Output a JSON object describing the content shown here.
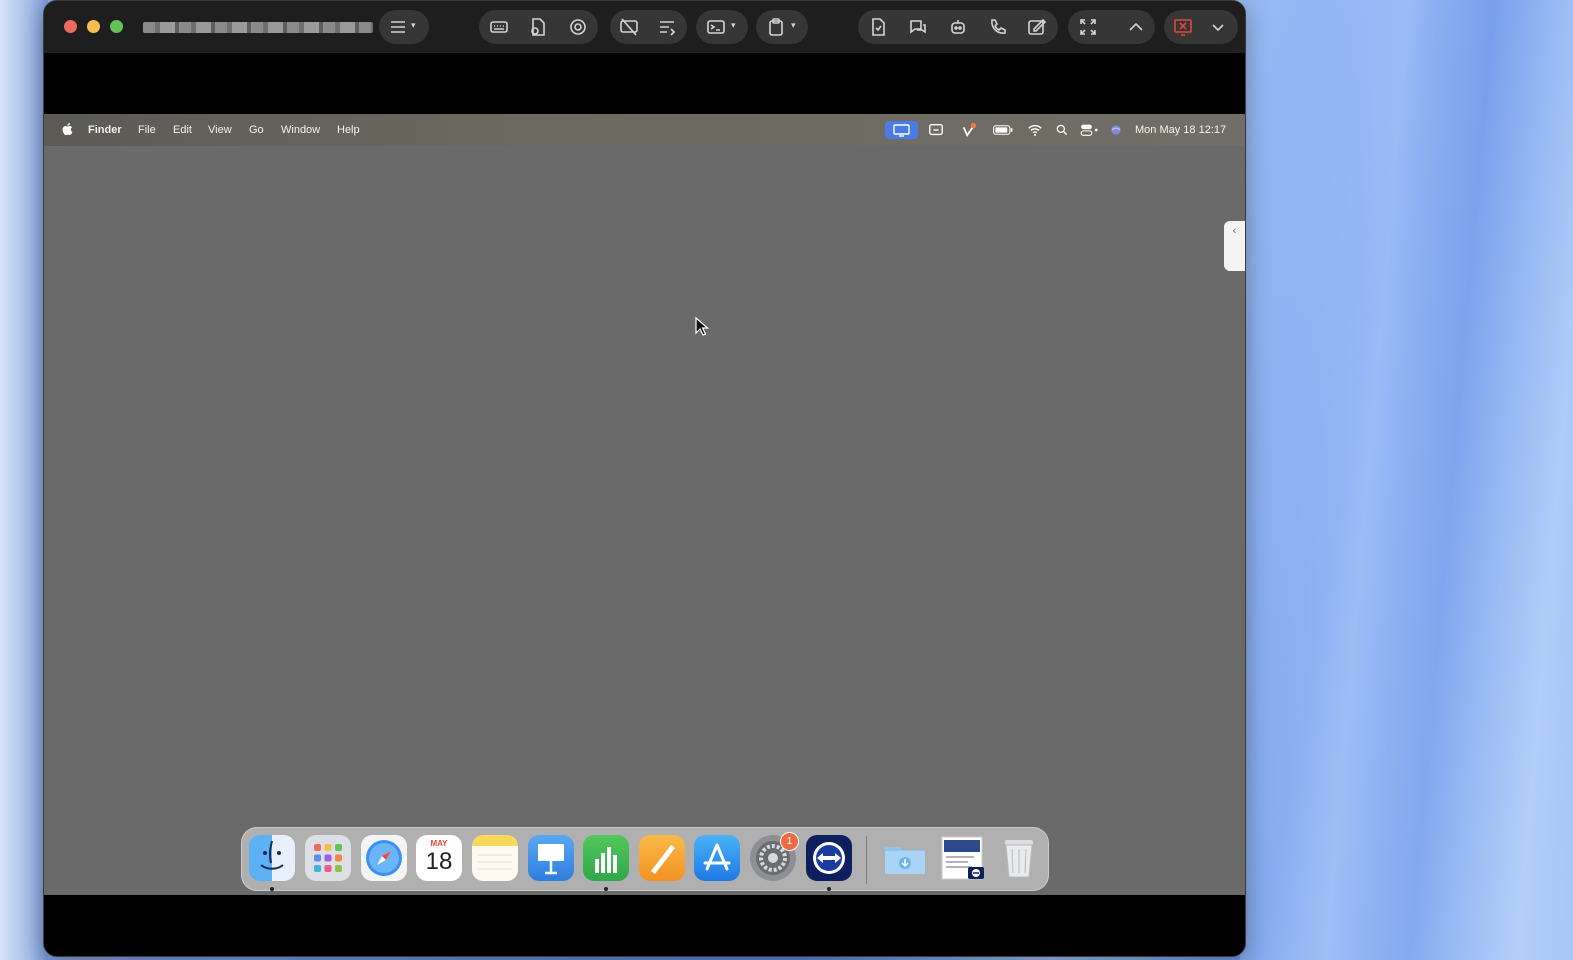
{
  "window": {
    "session_title": "▮▯▮▯ ▮▯▮▯▮▯ ▮▯▮",
    "toolbar": {
      "icons": [
        "menu-icon",
        "keyboard-icon",
        "file-transfer-icon",
        "record-icon",
        "hide-remote-cursor-icon",
        "text-actions-icon",
        "terminal-icon",
        "clipboard-icon",
        "file-icon",
        "chat-icon",
        "assistant-icon",
        "call-icon",
        "whiteboard-icon",
        "fullscreen-icon",
        "chevron-up-icon",
        "end-session-icon",
        "chevron-down-icon"
      ]
    },
    "colors": {
      "close": "#ed6a5e",
      "minimize": "#f5bf4f",
      "maximize": "#61c554",
      "accent": "#4a7be6",
      "end_session": "#e0483b"
    }
  },
  "remote": {
    "menubar": {
      "app_name": "Finder",
      "menus": [
        "File",
        "Edit",
        "View",
        "Go",
        "Window",
        "Help"
      ],
      "status_icons": [
        "screen-sharing-icon",
        "screen-mirroring-icon",
        "vpn-icon",
        "battery-icon",
        "wifi-icon",
        "spotlight-icon",
        "control-center-icon",
        "siri-icon"
      ],
      "clock": "Mon May 18  12:17"
    },
    "dock": {
      "apps": [
        {
          "name": "Finder",
          "running": true
        },
        {
          "name": "Launchpad",
          "running": false
        },
        {
          "name": "Safari",
          "running": false
        },
        {
          "name": "Calendar",
          "running": false,
          "month": "MAY",
          "day": "18"
        },
        {
          "name": "Notes",
          "running": false
        },
        {
          "name": "Keynote",
          "running": false
        },
        {
          "name": "Numbers",
          "running": true
        },
        {
          "name": "Pages",
          "running": false
        },
        {
          "name": "App Store",
          "running": false
        },
        {
          "name": "System Settings",
          "running": false,
          "badge": "1"
        },
        {
          "name": "TeamViewer",
          "running": true
        }
      ],
      "right": [
        "Downloads",
        "Screenshot",
        "Trash"
      ]
    }
  }
}
